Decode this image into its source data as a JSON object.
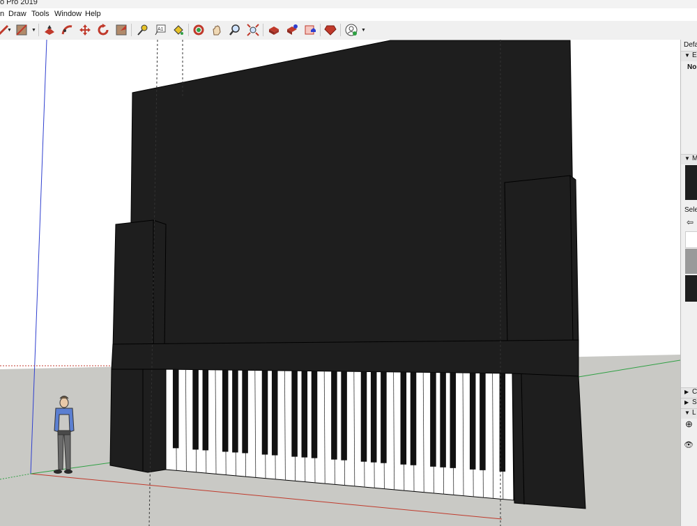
{
  "app": {
    "title": "o Pro 2019"
  },
  "menu": {
    "items": [
      "Draw",
      "Tools",
      "Window",
      "Help"
    ]
  },
  "toolbar": {
    "tools": [
      "pencil",
      "paint",
      "push-pull",
      "follow-me",
      "move",
      "rotate",
      "scale",
      "tape-measure",
      "text",
      "paint-bucket",
      "orbit",
      "pan",
      "zoom",
      "zoom-extents",
      "3d-warehouse",
      "extension-warehouse",
      "send-to-layout",
      "ruby-console",
      "profile"
    ]
  },
  "tray": {
    "title": "Defa",
    "entity_section": "E",
    "entity_value": "No",
    "materials_section": "M",
    "select_label": "Selec",
    "section_c": "C",
    "section_s": "S",
    "section_l": "L"
  },
  "colors": {
    "model_fill": "#1e1e1e",
    "ground": "#c9c9c5",
    "sky": "#ffffff",
    "axis_red": "#c0392b",
    "axis_green": "#2ea043",
    "axis_blue": "#2f3fcf"
  },
  "scene": {
    "figure": "person-figure",
    "keyboard": {
      "white_keys": 35,
      "black_keys": 25
    }
  }
}
